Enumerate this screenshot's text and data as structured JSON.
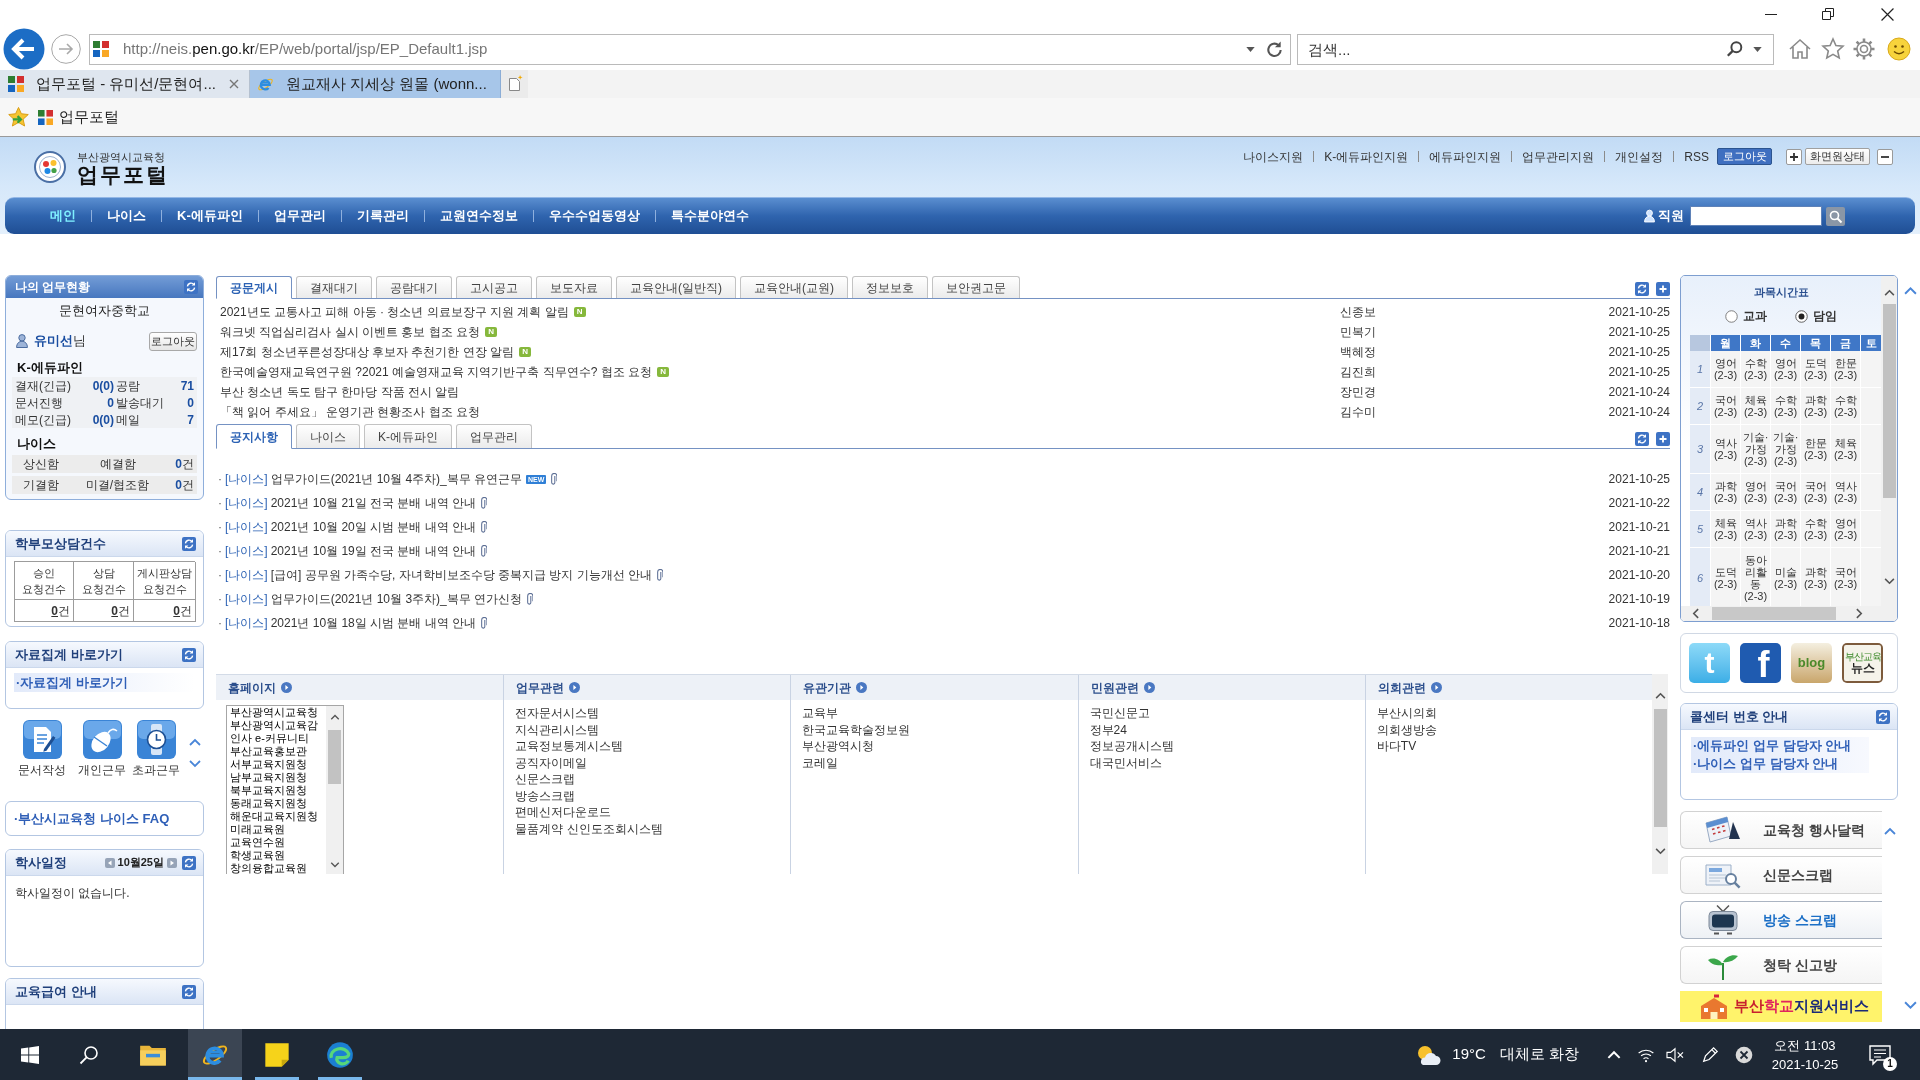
{
  "browser": {
    "address": {
      "prefix": "http://neis.",
      "domain": "pen.go.kr",
      "path": "/EP/web/portal/jsp/EP_Default1.jsp"
    },
    "search": {
      "placeholder": "검색..."
    },
    "tabs": [
      {
        "title": "업무포털 - 유미선/문현여...",
        "kind": "portal",
        "selected": true
      },
      {
        "title": "원교재사 지세상 원몰 (wonn...",
        "kind": "ie",
        "selected": false
      }
    ],
    "favorites": [
      {
        "label": "업무포털",
        "kind": "portal"
      }
    ]
  },
  "header": {
    "org": "부산광역시교육청",
    "title": "업무포털",
    "links": [
      "나이스지원",
      "K-에듀파인지원",
      "에듀파인지원",
      "업무관리지원",
      "개인설정",
      "RSS"
    ],
    "logout": "로그아웃",
    "reset": "화면원상태"
  },
  "nav": {
    "items": [
      {
        "label": "메인",
        "selected": true
      },
      {
        "label": "나이스",
        "selected": false
      },
      {
        "label": "K-에듀파인",
        "selected": false
      },
      {
        "label": "업무관리",
        "selected": false
      },
      {
        "label": "기록관리",
        "selected": false
      },
      {
        "label": "교원연수정보",
        "selected": false
      },
      {
        "label": "우수수업동영상",
        "selected": false
      },
      {
        "label": "특수분야연수",
        "selected": false
      }
    ],
    "search_label": "직원"
  },
  "my_work": {
    "title": "나의 업무현황",
    "school": "문현여자중학교",
    "user": "**유미선**님",
    "logout": "로그아웃",
    "edufine": {
      "title": "K-에듀파인",
      "rows": [
        [
          {
            "label": "결재(긴급)",
            "value": "0(0)"
          },
          {
            "label": "공람",
            "value": "71"
          }
        ],
        [
          {
            "label": "문서진행",
            "value": "0"
          },
          {
            "label": "발송대기",
            "value": "0"
          }
        ],
        [
          {
            "label": "메모(긴급)",
            "value": "0(0)"
          },
          {
            "label": "메일",
            "value": "7"
          }
        ]
      ]
    },
    "neis": {
      "title": "나이스",
      "rows": [
        {
          "label": "상신함",
          "sublabel": "예결함",
          "count": "**0**건"
        },
        {
          "label": "기결함",
          "sublabel": "미결/협조함",
          "count": "**0**건"
        }
      ]
    }
  },
  "counsel": {
    "title": "학부모상담건수",
    "columns": [
      {
        "header": "승인\n요청건수",
        "value": "**0**건"
      },
      {
        "header": "상담\n요청건수",
        "value": "**0**건"
      },
      {
        "header": "게시판상담\n요청건수",
        "value": "**0**건"
      }
    ]
  },
  "data_shortcut": {
    "title": "자료집계 바로가기",
    "link": "·자료집계 바로가기"
  },
  "quick_icons": [
    {
      "label": "문서작성",
      "kind": "document"
    },
    {
      "label": "개인근무",
      "kind": "mouse"
    },
    {
      "label": "초과근무",
      "kind": "watch"
    }
  ],
  "faq": {
    "link": "·부산시교육청 나이스 FAQ"
  },
  "schedule": {
    "title": "학사일정",
    "date": "10월25일",
    "message": "학사일정이 없습니다."
  },
  "edu_benefit": {
    "title": "교육급여 안내"
  },
  "documents": {
    "tabs": [
      {
        "label": "공문게시",
        "selected": true
      },
      {
        "label": "결재대기",
        "selected": false
      },
      {
        "label": "공람대기",
        "selected": false
      },
      {
        "label": "고시공고",
        "selected": false
      },
      {
        "label": "보도자료",
        "selected": false
      },
      {
        "label": "교육안내(일반직)",
        "selected": false
      },
      {
        "label": "교육안내(교원)",
        "selected": false
      },
      {
        "label": "정보보호",
        "selected": false
      },
      {
        "label": "보안권고문",
        "selected": false
      }
    ],
    "rows": [
      {
        "title": "2021년도 교통사고 피해 아동 · 청소년 의료보장구 지원 계획 알림",
        "badge": "N",
        "author": "신종보",
        "date": "2021-10-25"
      },
      {
        "title": "워크넷 직업심리검사 실시 이벤트 홍보 협조 요청",
        "badge": "N",
        "author": "민복기",
        "date": "2021-10-25"
      },
      {
        "title": "제17회 청소년푸른성장대상 후보자 추천기한 연장 알림",
        "badge": "N",
        "author": "백혜정",
        "date": "2021-10-25"
      },
      {
        "title": "한국예술영재교육연구원 ?2021 예술영재교육 지역기반구축 직무연수? 협조 요청",
        "badge": "N",
        "author": "김진희",
        "date": "2021-10-25"
      },
      {
        "title": "부산 청소년 독도 탐구 한마당 작품 전시 알림",
        "author": "장민경",
        "date": "2021-10-24"
      },
      {
        "title": "「책 읽어 주세요」 운영기관 현황조사 협조 요청",
        "author": "김수미",
        "date": "2021-10-24"
      }
    ]
  },
  "notices": {
    "tabs": [
      {
        "label": "공지사항",
        "selected": true
      },
      {
        "label": "나이스",
        "selected": false
      },
      {
        "label": "K-에듀파인",
        "selected": false
      },
      {
        "label": "업무관리",
        "selected": false
      }
    ],
    "rows": [
      {
        "bullet": "·",
        "category": "[나이스]",
        "title": "업무가이드(2021년 10월 4주차)_복무 유연근무",
        "badge": "NEW",
        "attachment": true,
        "date": "2021-10-25"
      },
      {
        "bullet": "·",
        "category": "[나이스]",
        "title": "2021년 10월 21일 전국 분배 내역 안내",
        "attachment": true,
        "date": "2021-10-22"
      },
      {
        "bullet": "·",
        "category": "[나이스]",
        "title": "2021년 10월 20일 시범 분배 내역 안내",
        "attachment": true,
        "date": "2021-10-21"
      },
      {
        "bullet": "·",
        "category": "[나이스]",
        "title": "2021년 10월 19일 전국 분배 내역 안내",
        "attachment": true,
        "date": "2021-10-21"
      },
      {
        "bullet": "·",
        "category": "[나이스]",
        "title": "[급여] 공무원 가족수당, 자녀학비보조수당 중복지급 방지 기능개선 안내",
        "attachment": true,
        "date": "2021-10-20"
      },
      {
        "bullet": "·",
        "category": "[나이스]",
        "title": "업무가이드(2021년 10월 3주차)_복무 연가신청",
        "attachment": true,
        "date": "2021-10-19"
      },
      {
        "bullet": "·",
        "category": "[나이스]",
        "title": "2021년 10월 18일 시범 분배 내역 안내",
        "attachment": true,
        "date": "2021-10-18"
      }
    ]
  },
  "links": {
    "columns": [
      {
        "title": "홈페이지",
        "kind": "listbox",
        "items": [
          "부산광역시교육청",
          "부산광역시교육감",
          "인사 e-커뮤니티",
          "부산교육홍보관",
          "서부교육지원청",
          "남부교육지원청",
          "북부교육지원청",
          "동래교육지원청",
          "해운대교육지원청",
          "미래교육원",
          "교육연수원",
          "학생교육원",
          "창의융합교육원"
        ]
      },
      {
        "title": "업무관련",
        "kind": "list",
        "items": [
          "전자문서시스템",
          "지식관리시스템",
          "교육정보통계시스템",
          "공직자이메일",
          "신문스크랩",
          "방송스크랩",
          "편메신저다운로드",
          "물품계약 신인도조회시스템"
        ]
      },
      {
        "title": "유관기관",
        "kind": "list",
        "items": [
          "교육부",
          "한국교육학술정보원",
          "부산광역시청",
          "코레일"
        ]
      },
      {
        "title": "민원관련",
        "kind": "list",
        "items": [
          "국민신문고",
          "정부24",
          "정보공개시스템",
          "대국민서비스"
        ]
      },
      {
        "title": "의회관련",
        "kind": "list",
        "items": [
          "부산시의회",
          "의회생방송",
          "바다TV"
        ]
      }
    ]
  },
  "timetable": {
    "title": "과목시간표",
    "options": [
      {
        "label": "교과",
        "selected": false
      },
      {
        "label": "담임",
        "selected": true
      }
    ],
    "days": [
      "월",
      "화",
      "수",
      "목",
      "금",
      "토"
    ],
    "rows": [
      {
        "period": "1",
        "cells": [
          {
            "subject": "영어",
            "class": "(2-3)"
          },
          {
            "subject": "수학",
            "class": "(2-3)"
          },
          {
            "subject": "영어",
            "class": "(2-3)"
          },
          {
            "subject": "도덕",
            "class": "(2-3)"
          },
          {
            "subject": "한문",
            "class": "(2-3)"
          }
        ]
      },
      {
        "period": "2",
        "cells": [
          {
            "subject": "국어",
            "class": "(2-3)"
          },
          {
            "subject": "체육",
            "class": "(2-3)"
          },
          {
            "subject": "수학",
            "class": "(2-3)"
          },
          {
            "subject": "과학",
            "class": "(2-3)"
          },
          {
            "subject": "수학",
            "class": "(2-3)"
          }
        ]
      },
      {
        "period": "3",
        "cells": [
          {
            "subject": "역사",
            "class": "(2-3)"
          },
          {
            "subject": "기술·가정",
            "class": "(2-3)"
          },
          {
            "subject": "기술·가정",
            "class": "(2-3)"
          },
          {
            "subject": "한문",
            "class": "(2-3)"
          },
          {
            "subject": "체육",
            "class": "(2-3)"
          }
        ]
      },
      {
        "period": "4",
        "cells": [
          {
            "subject": "과학",
            "class": "(2-3)"
          },
          {
            "subject": "영어",
            "class": "(2-3)"
          },
          {
            "subject": "국어",
            "class": "(2-3)"
          },
          {
            "subject": "국어",
            "class": "(2-3)"
          },
          {
            "subject": "역사",
            "class": "(2-3)"
          }
        ]
      },
      {
        "period": "5",
        "cells": [
          {
            "subject": "체육",
            "class": "(2-3)"
          },
          {
            "subject": "역사",
            "class": "(2-3)"
          },
          {
            "subject": "과학",
            "class": "(2-3)"
          },
          {
            "subject": "수학",
            "class": "(2-3)"
          },
          {
            "subject": "영어",
            "class": "(2-3)"
          }
        ]
      },
      {
        "period": "6",
        "cells": [
          {
            "subject": "도덕",
            "class": "(2-3)"
          },
          {
            "subject": "동아리활동",
            "class": "(2-3)"
          },
          {
            "subject": "미술",
            "class": "(2-3)"
          },
          {
            "subject": "과학",
            "class": "(2-3)"
          },
          {
            "subject": "국어",
            "class": "(2-3)"
          }
        ]
      }
    ]
  },
  "social": [
    {
      "kind": "twitter",
      "label": "t"
    },
    {
      "kind": "facebook",
      "label": "f"
    },
    {
      "kind": "blog",
      "label": "blog"
    },
    {
      "kind": "news",
      "label": "부산교육",
      "caption": "뉴스"
    }
  ],
  "call_center": {
    "title": "콜센터 번호 안내",
    "links": [
      "·에듀파인 업무 담당자 안내",
      "·나이스 업무 담당자 안내"
    ]
  },
  "quick_menu": [
    {
      "label": "교육청 행사달력",
      "kind": "calendar",
      "selected": false
    },
    {
      "label": "신문스크랩",
      "kind": "newspaper",
      "selected": false
    },
    {
      "label": "방송 스크랩",
      "kind": "tv",
      "selected": true
    },
    {
      "label": "청탁 신고방",
      "kind": "sprout",
      "selected": false
    }
  ],
  "banner": {
    "parts": [
      {
        "text": "부산",
        "color": "#c8202e"
      },
      {
        "text": "학교",
        "color": "#e0245e"
      },
      {
        "text": "지원서비스",
        "color": "#1b2a78"
      }
    ]
  },
  "taskbar": {
    "apps": [
      {
        "kind": "explorer",
        "active": false,
        "running": false
      },
      {
        "kind": "ie",
        "active": true,
        "running": true
      },
      {
        "kind": "notes",
        "active": false,
        "running": true
      },
      {
        "kind": "edge",
        "active": false,
        "running": true
      }
    ],
    "weather": {
      "temperature": "19°C",
      "condition": "대체로 화창"
    },
    "clock": {
      "time": "오전 11:03",
      "date": "2021-10-25"
    },
    "notification_count": "1"
  }
}
